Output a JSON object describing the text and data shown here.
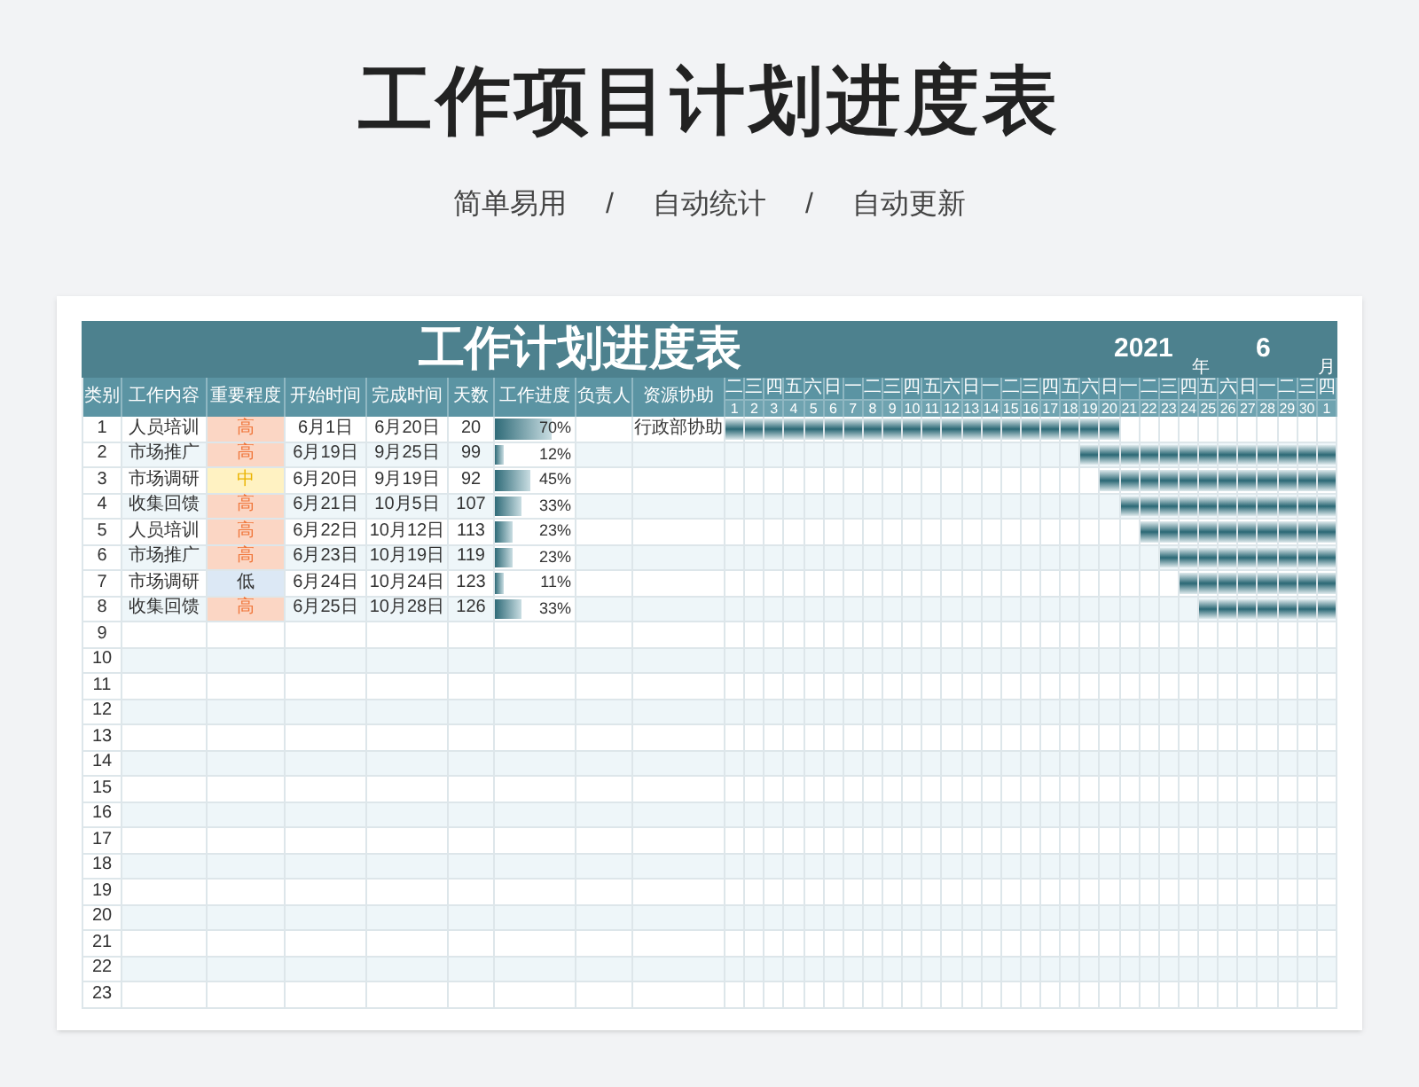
{
  "page_title": "工作项目计划进度表",
  "subtitle": {
    "items": [
      "简单易用",
      "自动统计",
      "自动更新"
    ],
    "separators": [
      "/",
      "/"
    ]
  },
  "sheet": {
    "title": "工作计划进度表",
    "year": "2021",
    "year_unit": "年",
    "month": "6",
    "month_unit": "月",
    "columns": [
      "类别",
      "工作内容",
      "重要程度",
      "开始时间",
      "完成时间",
      "天数",
      "工作进度",
      "负责人",
      "资源协助"
    ],
    "days": [
      {
        "weekday": "二",
        "day": "1"
      },
      {
        "weekday": "三",
        "day": "2"
      },
      {
        "weekday": "四",
        "day": "3"
      },
      {
        "weekday": "五",
        "day": "4"
      },
      {
        "weekday": "六",
        "day": "5"
      },
      {
        "weekday": "日",
        "day": "6"
      },
      {
        "weekday": "一",
        "day": "7"
      },
      {
        "weekday": "二",
        "day": "8"
      },
      {
        "weekday": "三",
        "day": "9"
      },
      {
        "weekday": "四",
        "day": "10"
      },
      {
        "weekday": "五",
        "day": "11"
      },
      {
        "weekday": "六",
        "day": "12"
      },
      {
        "weekday": "日",
        "day": "13"
      },
      {
        "weekday": "一",
        "day": "14"
      },
      {
        "weekday": "二",
        "day": "15"
      },
      {
        "weekday": "三",
        "day": "16"
      },
      {
        "weekday": "四",
        "day": "17"
      },
      {
        "weekday": "五",
        "day": "18"
      },
      {
        "weekday": "六",
        "day": "19"
      },
      {
        "weekday": "日",
        "day": "20"
      },
      {
        "weekday": "一",
        "day": "21"
      },
      {
        "weekday": "二",
        "day": "22"
      },
      {
        "weekday": "三",
        "day": "23"
      },
      {
        "weekday": "四",
        "day": "24"
      },
      {
        "weekday": "五",
        "day": "25"
      },
      {
        "weekday": "六",
        "day": "26"
      },
      {
        "weekday": "日",
        "day": "27"
      },
      {
        "weekday": "一",
        "day": "28"
      },
      {
        "weekday": "二",
        "day": "29"
      },
      {
        "weekday": "三",
        "day": "30"
      },
      {
        "weekday": "四",
        "day": "1"
      }
    ],
    "rows": [
      {
        "number": "1",
        "task": "人员培训",
        "priority": "高",
        "kind": "high",
        "start": "6月1日",
        "end": "6月20日",
        "days": "20",
        "level": 0.7,
        "progress": "70%",
        "support": "行政部协助",
        "filled": [
          true,
          true,
          true,
          true,
          true,
          true,
          true,
          true,
          true,
          true,
          true,
          true,
          true,
          true,
          true,
          true,
          true,
          true,
          true,
          true,
          false,
          false,
          false,
          false,
          false,
          false,
          false,
          false,
          false,
          false,
          false
        ]
      },
      {
        "number": "2",
        "task": "市场推广",
        "priority": "高",
        "kind": "high",
        "start": "6月19日",
        "end": "9月25日",
        "days": "99",
        "level": 0.12,
        "progress": "12%",
        "filled": [
          false,
          false,
          false,
          false,
          false,
          false,
          false,
          false,
          false,
          false,
          false,
          false,
          false,
          false,
          false,
          false,
          false,
          false,
          true,
          true,
          true,
          true,
          true,
          true,
          true,
          true,
          true,
          true,
          true,
          true,
          true
        ]
      },
      {
        "number": "3",
        "task": "市场调研",
        "priority": "中",
        "kind": "medium",
        "start": "6月20日",
        "end": "9月19日",
        "days": "92",
        "level": 0.45,
        "progress": "45%",
        "filled": [
          false,
          false,
          false,
          false,
          false,
          false,
          false,
          false,
          false,
          false,
          false,
          false,
          false,
          false,
          false,
          false,
          false,
          false,
          false,
          true,
          true,
          true,
          true,
          true,
          true,
          true,
          true,
          true,
          true,
          true,
          true
        ]
      },
      {
        "number": "4",
        "task": "收集回馈",
        "priority": "高",
        "kind": "high",
        "start": "6月21日",
        "end": "10月5日",
        "days": "107",
        "level": 0.33,
        "progress": "33%",
        "filled": [
          false,
          false,
          false,
          false,
          false,
          false,
          false,
          false,
          false,
          false,
          false,
          false,
          false,
          false,
          false,
          false,
          false,
          false,
          false,
          false,
          true,
          true,
          true,
          true,
          true,
          true,
          true,
          true,
          true,
          true,
          true
        ]
      },
      {
        "number": "5",
        "task": "人员培训",
        "priority": "高",
        "kind": "high",
        "start": "6月22日",
        "end": "10月12日",
        "days": "113",
        "level": 0.23,
        "progress": "23%",
        "filled": [
          false,
          false,
          false,
          false,
          false,
          false,
          false,
          false,
          false,
          false,
          false,
          false,
          false,
          false,
          false,
          false,
          false,
          false,
          false,
          false,
          false,
          true,
          true,
          true,
          true,
          true,
          true,
          true,
          true,
          true,
          true
        ]
      },
      {
        "number": "6",
        "task": "市场推广",
        "priority": "高",
        "kind": "high",
        "start": "6月23日",
        "end": "10月19日",
        "days": "119",
        "level": 0.23,
        "progress": "23%",
        "filled": [
          false,
          false,
          false,
          false,
          false,
          false,
          false,
          false,
          false,
          false,
          false,
          false,
          false,
          false,
          false,
          false,
          false,
          false,
          false,
          false,
          false,
          false,
          true,
          true,
          true,
          true,
          true,
          true,
          true,
          true,
          true
        ]
      },
      {
        "number": "7",
        "task": "市场调研",
        "priority": "低",
        "kind": "low",
        "start": "6月24日",
        "end": "10月24日",
        "days": "123",
        "level": 0.11,
        "progress": "11%",
        "filled": [
          false,
          false,
          false,
          false,
          false,
          false,
          false,
          false,
          false,
          false,
          false,
          false,
          false,
          false,
          false,
          false,
          false,
          false,
          false,
          false,
          false,
          false,
          false,
          true,
          true,
          true,
          true,
          true,
          true,
          true,
          true
        ]
      },
      {
        "number": "8",
        "task": "收集回馈",
        "priority": "高",
        "kind": "high",
        "start": "6月25日",
        "end": "10月28日",
        "days": "126",
        "level": 0.33,
        "progress": "33%",
        "filled": [
          false,
          false,
          false,
          false,
          false,
          false,
          false,
          false,
          false,
          false,
          false,
          false,
          false,
          false,
          false,
          false,
          false,
          false,
          false,
          false,
          false,
          false,
          false,
          false,
          true,
          true,
          true,
          true,
          true,
          true,
          true
        ]
      },
      {
        "number": "9"
      },
      {
        "number": "10"
      },
      {
        "number": "11"
      },
      {
        "number": "12"
      },
      {
        "number": "13"
      },
      {
        "number": "14"
      },
      {
        "number": "15"
      },
      {
        "number": "16"
      },
      {
        "number": "17"
      },
      {
        "number": "18"
      },
      {
        "number": "19"
      },
      {
        "number": "20"
      },
      {
        "number": "21"
      },
      {
        "number": "22"
      },
      {
        "number": "23"
      }
    ]
  }
}
